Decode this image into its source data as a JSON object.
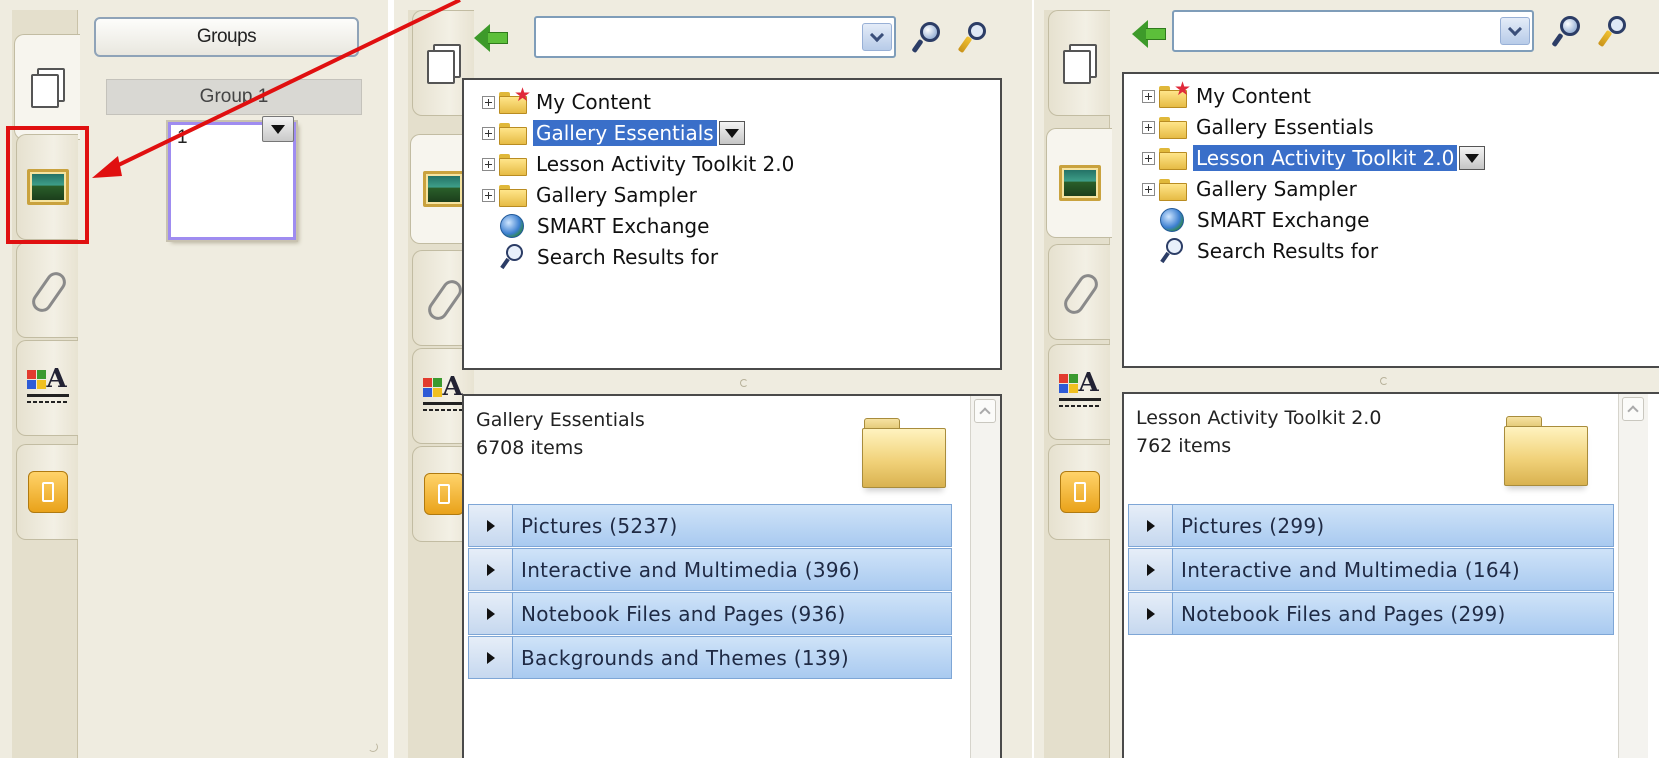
{
  "panel1": {
    "groups_button": "Groups",
    "group_header": "Group 1",
    "page_number": "1"
  },
  "tabs": [
    "page-sorter-icon",
    "gallery-icon",
    "attachments-icon",
    "properties-icon",
    "addons-icon"
  ],
  "gallery_left": {
    "search_value": "",
    "tree": [
      {
        "label": "My Content",
        "type": "folder-star"
      },
      {
        "label": "Gallery Essentials",
        "type": "folder",
        "selected": true
      },
      {
        "label": "Lesson Activity Toolkit 2.0",
        "type": "folder"
      },
      {
        "label": "Gallery Sampler",
        "type": "folder"
      },
      {
        "label": "SMART Exchange",
        "type": "globe"
      },
      {
        "label": "Search Results for",
        "type": "search"
      }
    ],
    "content_title": "Gallery Essentials",
    "content_count": "6708 items",
    "categories": [
      "Pictures (5237)",
      "Interactive and Multimedia (396)",
      "Notebook Files and Pages (936)",
      "Backgrounds and Themes (139)"
    ]
  },
  "gallery_right": {
    "search_value": "",
    "tree": [
      {
        "label": "My Content",
        "type": "folder-star"
      },
      {
        "label": "Gallery Essentials",
        "type": "folder"
      },
      {
        "label": "Lesson Activity Toolkit 2.0",
        "type": "folder",
        "selected": true
      },
      {
        "label": "Gallery Sampler",
        "type": "folder"
      },
      {
        "label": "SMART Exchange",
        "type": "globe"
      },
      {
        "label": "Search Results for",
        "type": "search"
      }
    ],
    "content_title": "Lesson Activity Toolkit 2.0",
    "content_count": "762 items",
    "categories": [
      "Pictures (299)",
      "Interactive and Multimedia (164)",
      "Notebook Files and Pages (299)"
    ]
  },
  "colors": {
    "highlight_box": "#e01010",
    "selection": "#3a6fc9",
    "category_bg": "#a9caf0"
  }
}
